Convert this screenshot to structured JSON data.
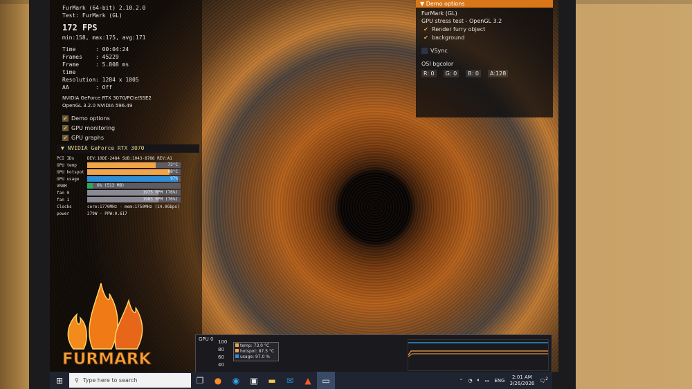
{
  "hud": {
    "title_line1": "FurMark (64-bit) 2.10.2.0",
    "title_line2": "Test: FurMark (GL)",
    "fps": "172 FPS",
    "fps_stats": "min:158, max:175, avg:171",
    "stats": [
      {
        "key": "Time",
        "value": ": 00:04:24"
      },
      {
        "key": "Frames",
        "value": ": 45229"
      },
      {
        "key": "Frame time",
        "value": ": 5.808 ms"
      },
      {
        "key": "Resolution",
        "value": ": 1284 x 1005"
      },
      {
        "key": "AA",
        "value": ": Off"
      }
    ],
    "gpu_line1": "NVIDIA GeForce RTX 3070/PCIe/SSE2",
    "gpu_line2": "OpenGL 3.2.0 NVIDIA 596.49",
    "options": [
      "Demo options",
      "GPU monitoring",
      "GPU graphs"
    ]
  },
  "gpu_panel": {
    "title": "NVIDIA GeForce RTX 3070",
    "pci_label": "PCI IDs",
    "pci_value": "DEV:10DE-2484 SUB:1043-8788 REV:A1",
    "bars": [
      {
        "label": "GPU temp",
        "text": "73°C",
        "level": 0.73,
        "color": "#f0a54a"
      },
      {
        "label": "GPU hotspot",
        "text": "88°C",
        "level": 0.88,
        "color": "#f0a54a"
      },
      {
        "label": "GPU usage",
        "text": "97%",
        "level": 0.97,
        "color": "#2f8ed8"
      },
      {
        "label": "VRAM",
        "text": "6% (513 MB)",
        "level": 0.06,
        "color": "#2fa860"
      },
      {
        "label": "fan 0",
        "text": "1975 RPM (76%)",
        "level": 0.76,
        "color": "#8a8a96"
      },
      {
        "label": "fan 1",
        "text": "1983 RPM (76%)",
        "level": 0.76,
        "color": "#8a8a96"
      }
    ],
    "clocks_label": "Clocks",
    "clocks_value": "core:1770MHz - mem:1750MHz (14.0Gbps)",
    "power_label": "power",
    "power_value": "279W - PPW:0.617"
  },
  "logo_text": "FURMARK",
  "demo_options": {
    "header": "Demo options",
    "name": "FurMark (GL)",
    "subtitle": "GPU stress test - OpenGL 3.2",
    "render_furry": "Render furry object",
    "background": "background",
    "vsync": "VSync",
    "osi_label": "OSI bgcolor",
    "r": "R: 0",
    "g": "G: 0",
    "b": "B: 0",
    "a": "A:128"
  },
  "graph": {
    "label": "GPU 0",
    "yticks": [
      "100",
      "80",
      "60",
      "40"
    ],
    "legend": [
      {
        "text": "temp: 73.0 °C",
        "color": "#f0a54a"
      },
      {
        "text": "hotspot: 87.5 °C",
        "color": "#f0a54a"
      },
      {
        "text": "usage: 97.0 %",
        "color": "#2f8ed8"
      }
    ]
  },
  "taskbar": {
    "search_placeholder": "Type here to search",
    "language": "ENG",
    "time": "2:01 AM",
    "date": "3/26/2026",
    "notification_count": "2"
  }
}
